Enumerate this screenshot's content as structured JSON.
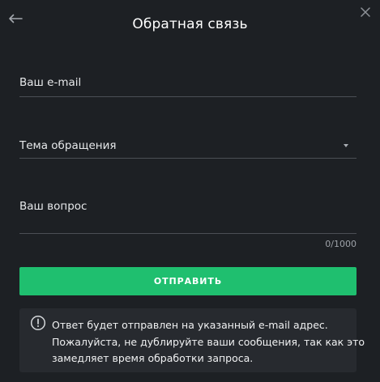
{
  "header": {
    "title": "Обратная связь",
    "back_icon": "arrow-left-icon",
    "close_icon": "close-icon"
  },
  "form": {
    "email_label": "Ваш e-mail",
    "topic_label": "Тема обращения",
    "topic_dropdown_icon": "caret-down-icon",
    "question_label": "Ваш вопрос",
    "question_counter": "0/1000",
    "submit_label": "ОТПРАВИТЬ"
  },
  "notice": {
    "icon": "info-icon",
    "lines": [
      "Ответ будет отправлен на указанный e-mail адрес.",
      "Пожалуйста, не дублируйте ваши сообщения, так как это",
      "замедляет время обработки запроса."
    ]
  },
  "colors": {
    "background": "#1d2024",
    "accent": "#1fbf6f",
    "notice_background": "#272a2f",
    "divider": "#4b4f55"
  }
}
